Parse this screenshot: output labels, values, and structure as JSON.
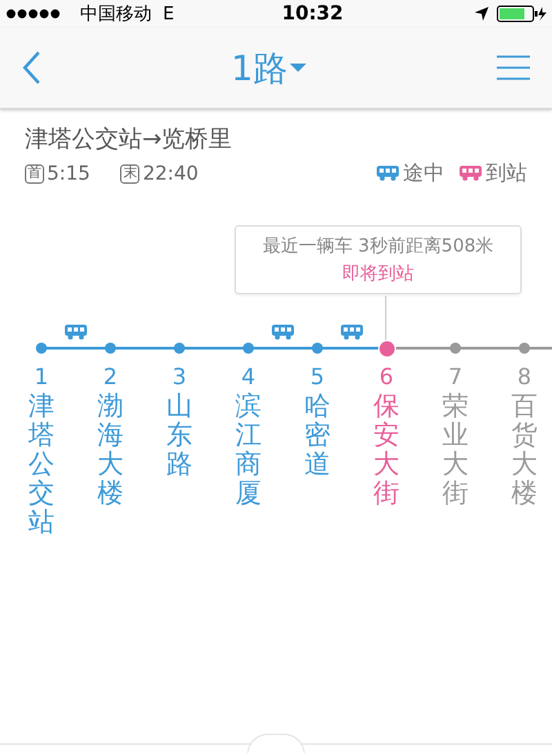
{
  "status_bar": {
    "carrier": "中国移动",
    "network": "E",
    "time": "10:32"
  },
  "nav": {
    "title": "1路"
  },
  "route": {
    "name": "津塔公交站→览桥里",
    "times": [
      {
        "badge": "首",
        "value": "5:15"
      },
      {
        "badge": "末",
        "value": "22:40"
      }
    ],
    "legend": [
      {
        "kind": "moving",
        "label": "途中"
      },
      {
        "kind": "arrived",
        "label": "到站"
      }
    ]
  },
  "notice": {
    "text": "最近一辆车 3秒前距离508米",
    "status": "即将到站"
  },
  "stops": [
    {
      "number": "1",
      "name": "津塔公交站",
      "passed": true,
      "selected": false,
      "bus_after": true
    },
    {
      "number": "2",
      "name": "渤海大楼",
      "passed": true,
      "selected": false,
      "bus_after": false
    },
    {
      "number": "3",
      "name": "山东路",
      "passed": true,
      "selected": false,
      "bus_after": false
    },
    {
      "number": "4",
      "name": "滨江商厦",
      "passed": true,
      "selected": false,
      "bus_after": true
    },
    {
      "number": "5",
      "name": "哈密道",
      "passed": true,
      "selected": false,
      "bus_after": true
    },
    {
      "number": "6",
      "name": "保安大街",
      "passed": false,
      "selected": true,
      "bus_after": false
    },
    {
      "number": "7",
      "name": "荣业大街",
      "passed": false,
      "selected": false,
      "bus_after": false
    },
    {
      "number": "8",
      "name": "百货大楼",
      "passed": false,
      "selected": false,
      "bus_after": false
    }
  ]
}
